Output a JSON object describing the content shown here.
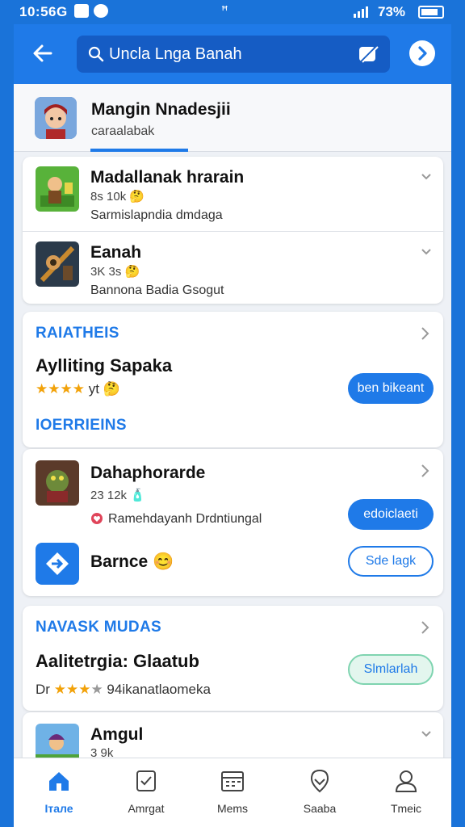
{
  "status_bar": {
    "time": "10:56G",
    "center": "ꟸ",
    "battery_pct": "73%"
  },
  "search": {
    "query": "Unclа Lnga Banah"
  },
  "header": {
    "title": "Mangin Nnadesjiі",
    "subtitle": "caraalabak"
  },
  "list1": [
    {
      "title": "Madallanak hrarain",
      "meta": "8s 10k 🤔",
      "desc": "Sarmislapndia dmdaga"
    },
    {
      "title": "Eanah",
      "meta": "3K 3s 🤔",
      "desc": "Bannona Badia Gsogut"
    }
  ],
  "card1": {
    "section": "RAIATHEIS",
    "title": "Aylliting Sapaka",
    "rating_text": "yt 🤔",
    "stars": 4,
    "button": "ben bikeant",
    "sub_section": "IOERRIEINS"
  },
  "card2": {
    "title": "Dahaphorarde",
    "meta": "23 12k 🧴",
    "desc": "Ramehdayanh Drdntiungal",
    "button1": "edoiclaeti",
    "app2_title": "Barnce 😊",
    "button2": "Sde lagk"
  },
  "card3": {
    "section": "NAVASK MUDAS",
    "title": "Aalitetrgia: Glaatub",
    "rating_prefix": "Dr",
    "rating_text": "94ikanatlaomeka",
    "stars": 3,
    "button": "Slmlarlah"
  },
  "card4": {
    "title": "Amgul",
    "meta": "3 9k"
  },
  "nav": [
    {
      "label": "Італе",
      "icon": "home-icon"
    },
    {
      "label": "Amrgat",
      "icon": "tablet-icon"
    },
    {
      "label": "Mems",
      "icon": "calendar-icon"
    },
    {
      "label": "Saaba",
      "icon": "location-icon"
    },
    {
      "label": "Tmeic",
      "icon": "person-icon"
    }
  ],
  "colors": {
    "accent": "#1f7ae8",
    "star": "#f2a20a"
  }
}
